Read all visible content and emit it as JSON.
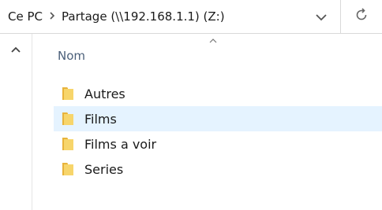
{
  "addressbar": {
    "breadcrumbs": [
      "Ce PC",
      "Partage (\\\\192.168.1.1) (Z:)"
    ],
    "dropdown_icon": "chevron-down-icon",
    "refresh_icon": "refresh-icon"
  },
  "navpane": {
    "up_icon": "chevron-up-icon"
  },
  "list": {
    "column_header": "Nom",
    "sort_icon": "sort-ascending-icon",
    "items": [
      {
        "label": "Autres",
        "icon": "folder-icon",
        "selected": false
      },
      {
        "label": "Films",
        "icon": "folder-icon",
        "selected": true
      },
      {
        "label": "Films a voir",
        "icon": "folder-icon",
        "selected": false
      },
      {
        "label": "Series",
        "icon": "folder-icon",
        "selected": false
      }
    ]
  },
  "colors": {
    "selection": "#e5f3ff",
    "folder": "#f2c94c",
    "header_text": "#4c607a"
  }
}
